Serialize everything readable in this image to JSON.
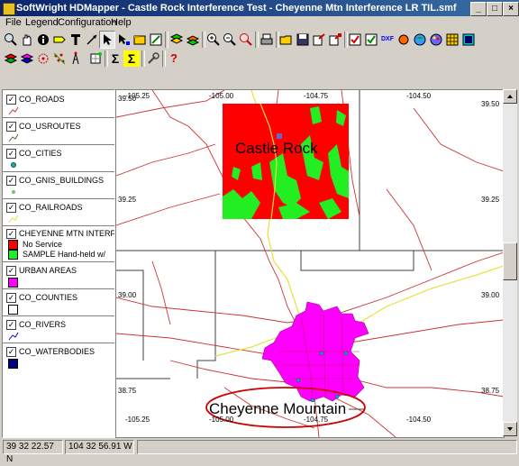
{
  "window": {
    "title": "SoftWright HDMapper - Castle Rock Interference Test - Cheyenne Mtn Interference LR TIL.smf"
  },
  "window_buttons": {
    "minimize": "_",
    "maximize": "□",
    "close": "×"
  },
  "menu": [
    "File",
    "Legend",
    "Configuration",
    "Help"
  ],
  "toolbar": {
    "dxf_label": "DXF",
    "sigma_label": "Σ",
    "sigma2_label": "Σ",
    "help_label": "?"
  },
  "legend": {
    "layers": [
      {
        "name": "CO_ROADS",
        "checked": true
      },
      {
        "name": "CO_USROUTES",
        "checked": true
      },
      {
        "name": "CO_CITIES",
        "checked": true
      },
      {
        "name": "CO_GNIS_BUILDINGS",
        "checked": true
      },
      {
        "name": "CO_RAILROADS",
        "checked": true
      },
      {
        "name": "CHEYENNE MTN INTERFE",
        "checked": true
      },
      {
        "name": "URBAN AREAS",
        "checked": true
      },
      {
        "name": "CO_COUNTIES",
        "checked": true
      },
      {
        "name": "CO_RIVERS",
        "checked": true
      },
      {
        "name": "CO_WATERBODIES",
        "checked": true
      }
    ],
    "sub_items": [
      {
        "label": "No Service",
        "color": "#ff0000"
      },
      {
        "label": "SAMPLE Hand-held w/",
        "color": "#22ee22"
      }
    ],
    "check_mark": "✓"
  },
  "map": {
    "lon_top": [
      "-105.25",
      "-105.00",
      "-104.75",
      "-104.50"
    ],
    "lon_bottom": [
      "-105.25",
      "-105.00",
      "-104.75",
      "-104.50"
    ],
    "lat_left": [
      "39.50",
      "39.25",
      "39.00",
      "38.75"
    ],
    "lat_right": [
      "39.50",
      "39.25",
      "39.00",
      "38.75"
    ],
    "city_top": "Castle Rock",
    "city_bottom": "Cheyenne Mountain",
    "colors": {
      "coverage_red": "#ff0000",
      "coverage_green": "#22ee22",
      "urban": "#ff00ff",
      "roads": "#cc3333",
      "routes": "#e8e040",
      "county": "#404040",
      "highlight": "#cc0000"
    }
  },
  "status": {
    "lat": "39 32 22.57 N",
    "lon": "104 32 56.91 W"
  }
}
